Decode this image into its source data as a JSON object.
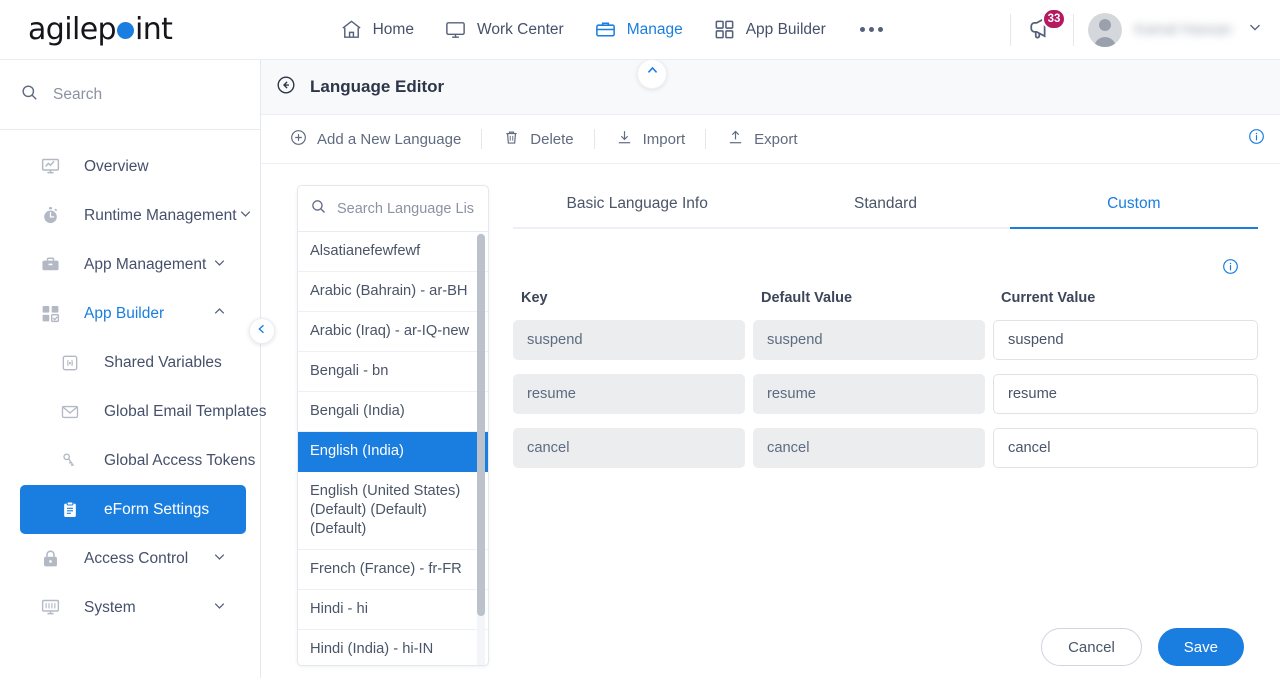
{
  "brand": {
    "name_part1": "agilep",
    "name_part2": "int",
    "accent": "#1a7ee0"
  },
  "topnav": {
    "items": [
      {
        "label": "Home",
        "icon": "home-icon",
        "active": false
      },
      {
        "label": "Work Center",
        "icon": "monitor-icon",
        "active": false
      },
      {
        "label": "Manage",
        "icon": "briefcase-icon",
        "active": true
      },
      {
        "label": "App Builder",
        "icon": "grid-icon",
        "active": false
      }
    ],
    "overflow_label": "...",
    "notification_count": "33",
    "username": "Kamal Hassan"
  },
  "sidebar": {
    "search_placeholder": "Search",
    "items": [
      {
        "label": "Overview",
        "icon": "chart-monitor-icon",
        "expandable": false,
        "state": "normal"
      },
      {
        "label": "Runtime Management",
        "icon": "stopwatch-icon",
        "expandable": true,
        "state": "normal"
      },
      {
        "label": "App Management",
        "icon": "toolbox-icon",
        "expandable": true,
        "state": "normal"
      },
      {
        "label": "App Builder",
        "icon": "grid-check-icon",
        "expandable": true,
        "expanded": true,
        "state": "accent"
      },
      {
        "label": "Shared Variables",
        "icon": "variable-icon",
        "expandable": false,
        "state": "sub"
      },
      {
        "label": "Global Email Templates",
        "icon": "envelope-icon",
        "expandable": false,
        "state": "sub"
      },
      {
        "label": "Global Access Tokens",
        "icon": "keys-icon",
        "expandable": false,
        "state": "sub"
      },
      {
        "label": "eForm Settings",
        "icon": "clipboard-icon",
        "expandable": false,
        "state": "selected"
      },
      {
        "label": "Access Control",
        "icon": "lock-icon",
        "expandable": true,
        "state": "normal"
      },
      {
        "label": "System",
        "icon": "system-monitor-icon",
        "expandable": true,
        "state": "normal"
      }
    ]
  },
  "page": {
    "title": "Language Editor",
    "back_icon": "back-arrow-icon",
    "collapse_icon": "chevron-up-icon"
  },
  "toolbar": {
    "add_label": "Add a New Language",
    "delete_label": "Delete",
    "import_label": "Import",
    "export_label": "Export",
    "info_icon": "info-icon"
  },
  "language_list": {
    "search_placeholder": "Search Language Lis",
    "items": [
      {
        "label": "Alsatianefewfewf",
        "selected": false
      },
      {
        "label": "Arabic (Bahrain) - ar-BH",
        "selected": false
      },
      {
        "label": "Arabic (Iraq) - ar-IQ-new",
        "selected": false
      },
      {
        "label": "Bengali - bn",
        "selected": false
      },
      {
        "label": "Bengali (India)",
        "selected": false
      },
      {
        "label": "English (India)",
        "selected": true
      },
      {
        "label": "English (United States) (Default) (Default) (Default)",
        "selected": false
      },
      {
        "label": "French (France) - fr-FR",
        "selected": false
      },
      {
        "label": "Hindi - hi",
        "selected": false
      },
      {
        "label": "Hindi (India) - hi-IN",
        "selected": false
      }
    ]
  },
  "tabs": [
    {
      "label": "Basic Language Info",
      "active": false
    },
    {
      "label": "Standard",
      "active": false
    },
    {
      "label": "Custom",
      "active": true
    }
  ],
  "grid": {
    "columns": [
      "Key",
      "Default Value",
      "Current Value"
    ],
    "rows": [
      {
        "key": "suspend",
        "default_value": "suspend",
        "current_value": "suspend"
      },
      {
        "key": "resume",
        "default_value": "resume",
        "current_value": "resume"
      },
      {
        "key": "cancel",
        "default_value": "cancel",
        "current_value": "cancel"
      }
    ]
  },
  "footer": {
    "cancel_label": "Cancel",
    "save_label": "Save"
  }
}
